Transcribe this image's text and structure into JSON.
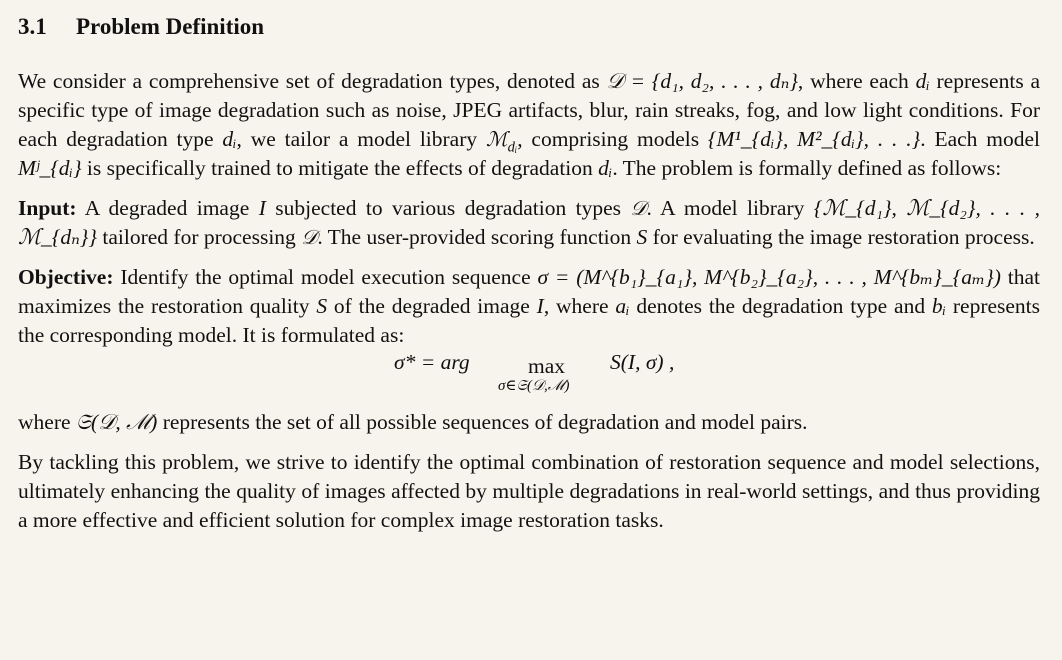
{
  "section": {
    "number": "3.1",
    "title": "Problem Definition"
  },
  "paragraphs": {
    "p1": {
      "a": "We consider a comprehensive set of degradation types, denoted as ",
      "set_D": "𝒟 = {d₁, d₂, . . . , dₙ}",
      "b": ", where each ",
      "di": "dᵢ",
      "c": " represents a specific type of image degradation such as noise, JPEG artifacts, blur, rain streaks, fog, and low light conditions. For each degradation type ",
      "di2": "dᵢ",
      "d": ", we tailor a model library ",
      "lib": "ℳ",
      "lib_sub": "dᵢ",
      "e": ", comprising models ",
      "models": "{M¹_{dᵢ}, M²_{dᵢ}, . . .}",
      "f": ". Each model ",
      "mj": "Mʲ_{dᵢ}",
      "g": " is specifically trained to mitigate the effects of degradation ",
      "di3": "dᵢ",
      "h": ". The problem is formally defined as follows:"
    },
    "input": {
      "lead": "Input:",
      "a": " A degraded image ",
      "I": "I",
      "b": " subjected to various degradation types ",
      "D": "𝒟",
      "c": ". A model library ",
      "libs": "{ℳ_{d₁}, ℳ_{d₂}, . . . , ℳ_{dₙ}}",
      "d": " tailored for processing ",
      "D2": "𝒟",
      "e": ". The user-provided scoring function ",
      "S": "S",
      "f": " for evaluating the image restoration process."
    },
    "objective": {
      "lead": "Objective:",
      "a": " Identify the optimal model execution sequence ",
      "sigma": "σ = (M^{b₁}_{a₁}, M^{b₂}_{a₂}, . . . , M^{bₘ}_{aₘ})",
      "b": " that maximizes the restoration quality ",
      "S": "S",
      "c": " of the degraded image ",
      "I": "I",
      "d": ", where ",
      "ai": "aᵢ",
      "e": " denotes the degradation type and ",
      "bi": "bᵢ",
      "f": " represents the corresponding model. It is formulated as:"
    },
    "equation": {
      "lhs": "σ* = arg",
      "op": "max",
      "under": "σ∈𝔖(𝒟,ℳ)",
      "rhs": "S(I, σ) ,"
    },
    "where": {
      "a": "where ",
      "set": "𝔖(𝒟, ℳ)",
      "b": " represents the set of all possible sequences of degradation and model pairs."
    },
    "closing": "By tackling this problem, we strive to identify the optimal combination of restoration sequence and model selections, ultimately enhancing the quality of images affected by multiple degradations in real-world settings, and thus providing a more effective and efficient solution for complex image restoration tasks."
  }
}
